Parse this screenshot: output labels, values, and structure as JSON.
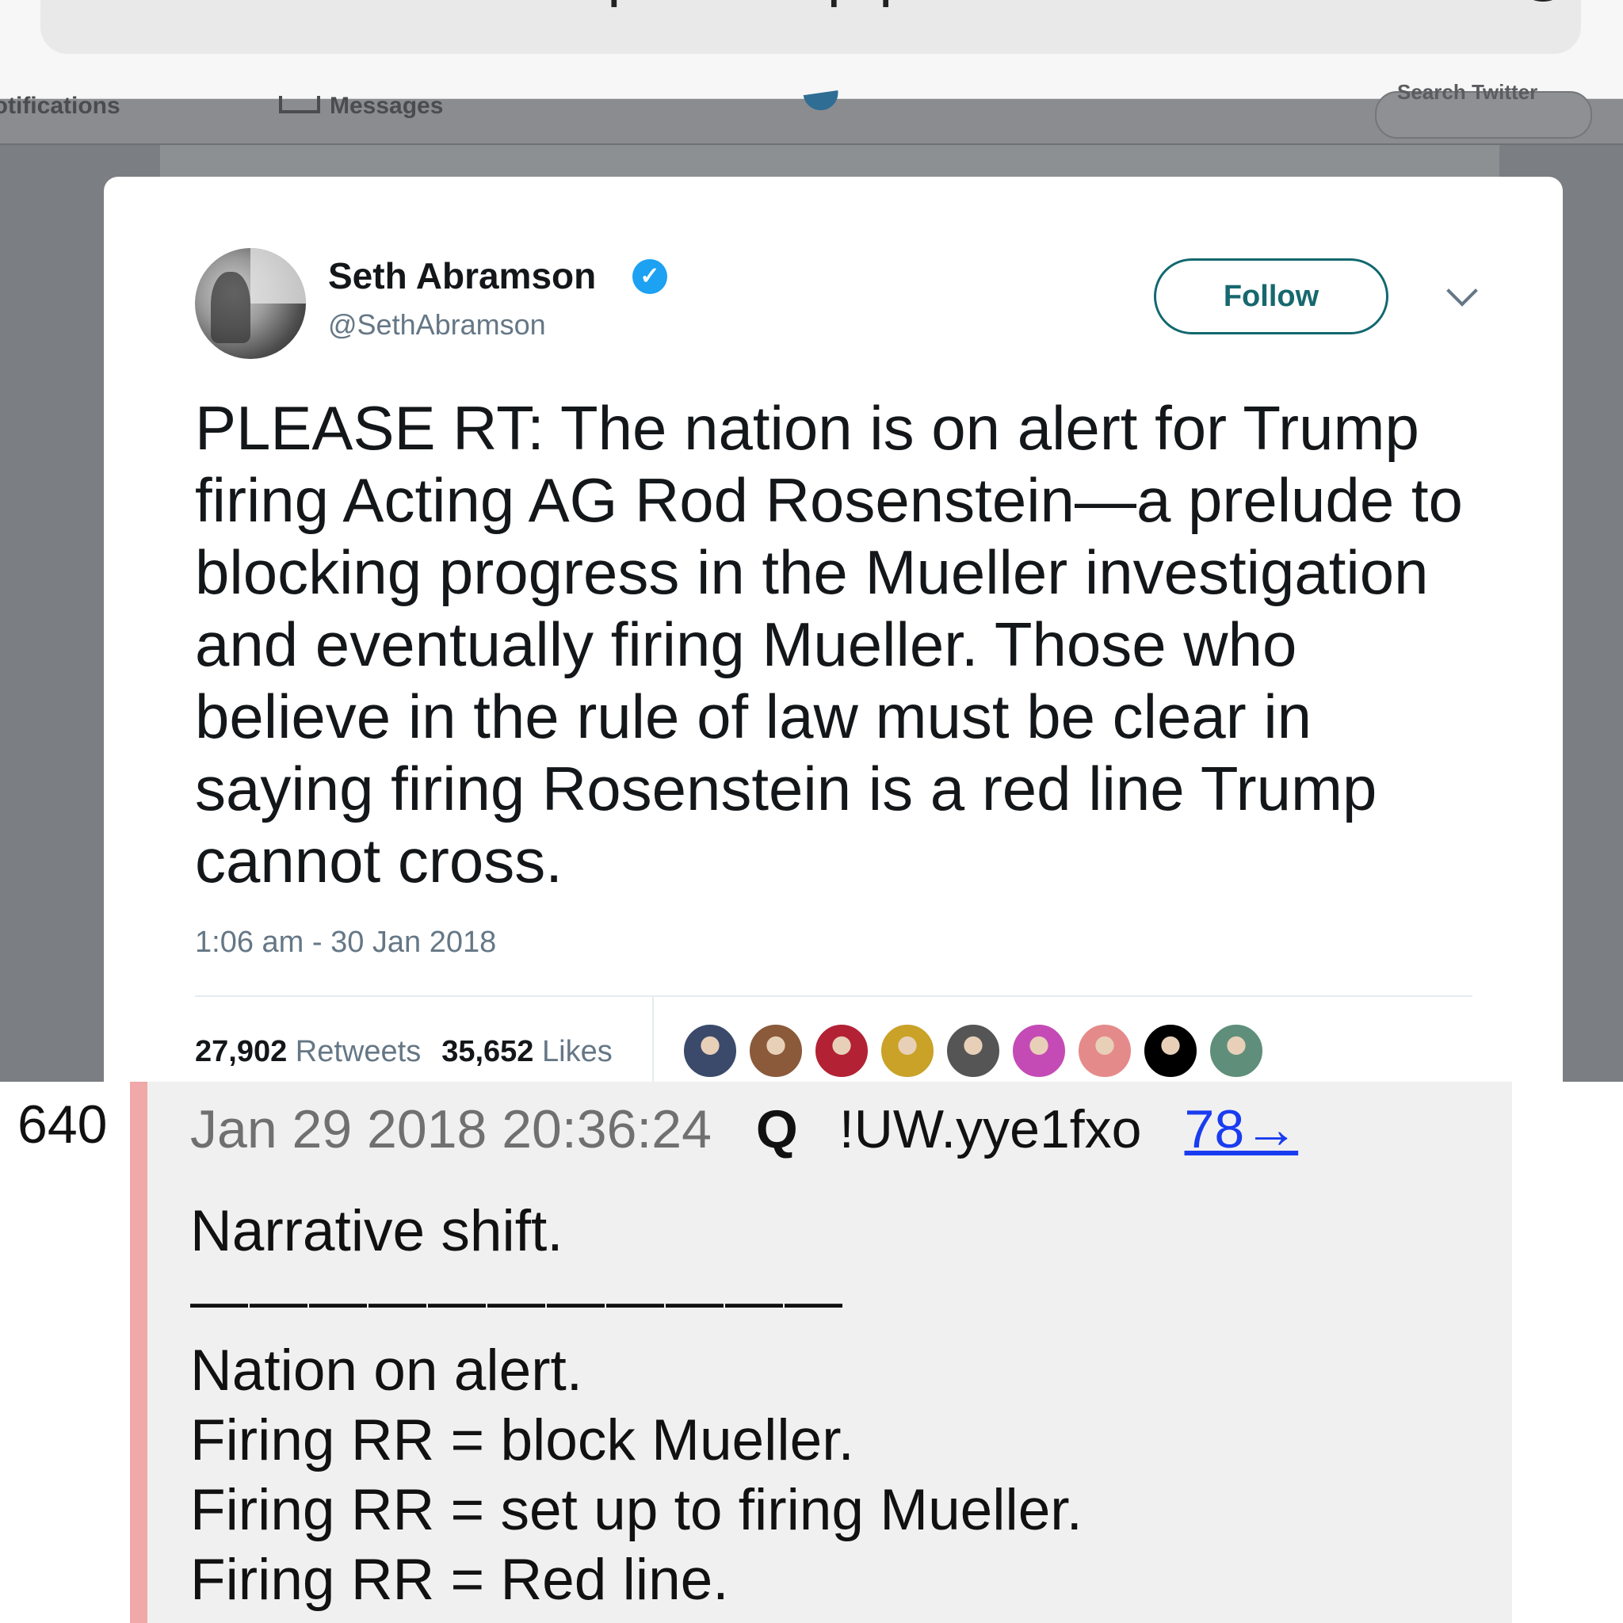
{
  "browser": {
    "url_text": "qoodeluq.qithub.io"
  },
  "twitter_nav": {
    "notifications_label": "Notifications",
    "messages_label": "Messages",
    "search_placeholder": "Search Twitter"
  },
  "tweet": {
    "user_name": "Seth Abramson",
    "handle": "@SethAbramson",
    "follow_label": "Follow",
    "text": "PLEASE RT: The nation is on alert for Trump firing Acting AG Rod Rosenstein—a prelude to blocking progress in the Mueller investigation and eventually firing Mueller. Those who believe in the rule of law must be clear in saying firing Rosenstein is a red line Trump cannot cross.",
    "timestamp": "1:06 am - 30 Jan 2018",
    "retweets_count": "27,902",
    "retweets_label": "Retweets",
    "likes_count": "35,652",
    "likes_label": "Likes",
    "liker_avatar_colors": [
      "#3b4a6b",
      "#8a5a3a",
      "#b22234",
      "#c9a227",
      "#555555",
      "#c44bb5",
      "#e58a8a",
      "#000000",
      "#5f8f7a"
    ]
  },
  "post": {
    "number": "640",
    "date": "Jan 29 2018 20:36:24",
    "author": "Q",
    "tripcode": "!UW.yye1fxo",
    "reply_link": "78→",
    "lines": [
      "Narrative shift.",
      "———————————",
      "Nation on alert.",
      "Firing RR = block Mueller.",
      "Firing RR = set up to firing Mueller.",
      "Firing RR = Red line."
    ]
  },
  "colors": {
    "accent_bar": "#f0a8a8",
    "link": "#1a3cf0",
    "verified": "#1da1f2",
    "follow_border": "#12686f"
  }
}
